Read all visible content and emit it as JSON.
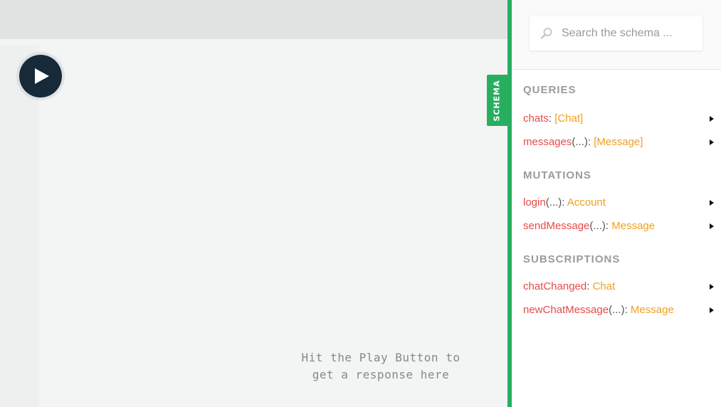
{
  "editor": {
    "response_hint_line1": "Hit the Play Button to",
    "response_hint_line2": "get a response here"
  },
  "schema_tab": {
    "label": "SCHEMA"
  },
  "search": {
    "placeholder": "Search the schema ..."
  },
  "sections": {
    "queries": {
      "title": "QUERIES",
      "fields": [
        {
          "name": "chats",
          "args": "",
          "type": "[Chat]"
        },
        {
          "name": "messages",
          "args": "(...)",
          "type": "[Message]"
        }
      ]
    },
    "mutations": {
      "title": "MUTATIONS",
      "fields": [
        {
          "name": "login",
          "args": "(...)",
          "type": "Account"
        },
        {
          "name": "sendMessage",
          "args": "(...)",
          "type": "Message"
        }
      ]
    },
    "subscriptions": {
      "title": "SUBSCRIPTIONS",
      "fields": [
        {
          "name": "chatChanged",
          "args": "",
          "type": "Chat"
        },
        {
          "name": "newChatMessage",
          "args": "(...)",
          "type": "Message"
        }
      ]
    }
  },
  "icons": {
    "play": "play-icon",
    "search": "search-icon",
    "expand": "triangle-right-icon"
  },
  "colors": {
    "accent": "#27ae60",
    "field_name": "#e84a4a",
    "field_type": "#f0a020",
    "play_button": "#172a3a"
  }
}
